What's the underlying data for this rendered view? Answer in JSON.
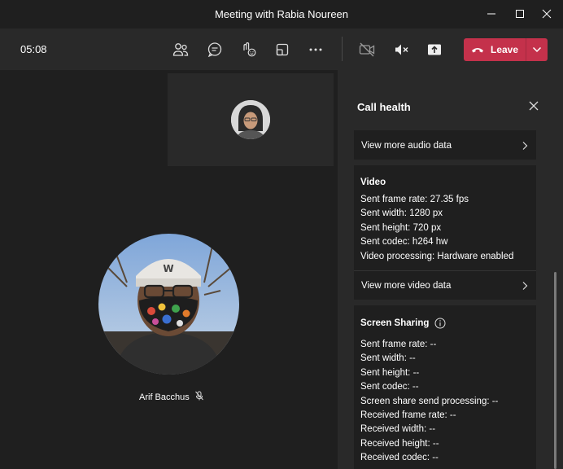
{
  "window": {
    "title": "Meeting with Rabia Noureen",
    "minimize_icon": "minimize-icon",
    "maximize_icon": "maximize-icon",
    "close_icon": "close-icon"
  },
  "toolbar": {
    "timer": "05:08",
    "icons": [
      "people-icon",
      "chat-icon",
      "reactions-icon",
      "rooms-icon",
      "more-icon",
      "camera-off-icon",
      "mic-muted-icon",
      "share-icon"
    ],
    "leave_label": "Leave",
    "leave_color": "#c4314b"
  },
  "stage": {
    "participant_name": "Arif Bacchus",
    "participant_status_icon": "mic-off-icon"
  },
  "panel": {
    "title": "Call health",
    "audio_link": "View more audio data",
    "video": {
      "heading": "Video",
      "stats": [
        "Sent frame rate: 27.35 fps",
        "Sent width: 1280 px",
        "Sent height: 720 px",
        "Sent codec: h264 hw",
        "Video processing: Hardware enabled"
      ],
      "link": "View more video data"
    },
    "screen_sharing": {
      "heading": "Screen Sharing",
      "stats": [
        "Sent frame rate: --",
        "Sent width: --",
        "Sent height: --",
        "Sent codec: --",
        "Screen share send processing: --",
        "Received frame rate: --",
        "Received width: --",
        "Received height: --",
        "Received codec: --"
      ]
    }
  }
}
